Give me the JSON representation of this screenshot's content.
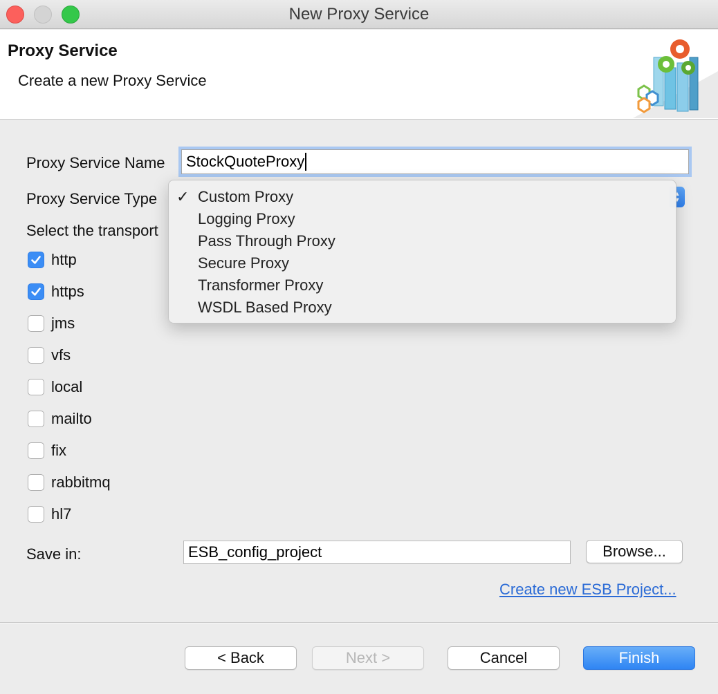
{
  "window": {
    "title": "New Proxy Service"
  },
  "banner": {
    "heading": "Proxy Service",
    "description": "Create a new Proxy Service"
  },
  "form": {
    "name_label": "Proxy Service Name",
    "name_value": "StockQuoteProxy",
    "type_label": "Proxy Service Type",
    "transport_label": "Select the transport",
    "save_in_label": "Save in:",
    "save_in_value": "ESB_config_project",
    "browse_label": "Browse...",
    "create_project_link": "Create new ESB Project..."
  },
  "transports": [
    {
      "label": "http",
      "checked": true
    },
    {
      "label": "https",
      "checked": true
    },
    {
      "label": "jms",
      "checked": false
    },
    {
      "label": "vfs",
      "checked": false
    },
    {
      "label": "local",
      "checked": false
    },
    {
      "label": "mailto",
      "checked": false
    },
    {
      "label": "fix",
      "checked": false
    },
    {
      "label": "rabbitmq",
      "checked": false
    },
    {
      "label": "hl7",
      "checked": false
    }
  ],
  "dropdown": {
    "selected": "Custom Proxy",
    "checkmark": "✓",
    "options": [
      "Custom Proxy",
      "Logging Proxy",
      "Pass Through Proxy",
      "Secure Proxy",
      "Transformer Proxy",
      "WSDL Based Proxy"
    ]
  },
  "buttons": {
    "back": "< Back",
    "next": "Next >",
    "cancel": "Cancel",
    "finish": "Finish"
  },
  "colors": {
    "accent": "#3b8df5",
    "link": "#2b6bd6",
    "focus_ring": "#a9c8f2"
  },
  "icons": {
    "banner_logo": "gears-bars-icon",
    "checkbox_mark": "checkmark-icon",
    "select_arrows": "updown-chevron-icon"
  }
}
